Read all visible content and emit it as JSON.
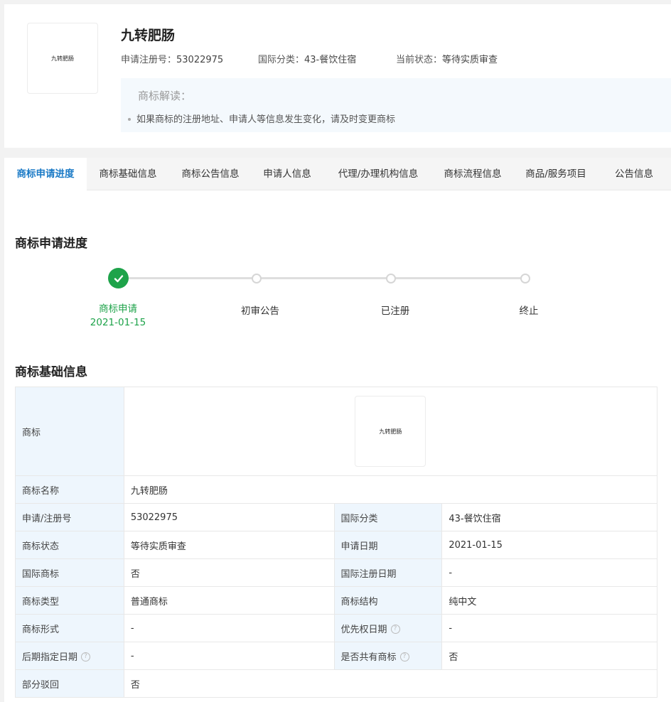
{
  "header": {
    "logo_text": "九转肥肠",
    "title": "九转肥肠",
    "reg_no_label": "申请注册号：",
    "reg_no": "53022975",
    "class_label": "国际分类：",
    "class_value": "43-餐饮住宿",
    "status_label": "当前状态：",
    "status_value": "等待实质审查",
    "interp_title": "商标解读：",
    "interp_item": "如果商标的注册地址、申请人等信息发生变化，请及时变更商标"
  },
  "tabs": [
    {
      "label": "商标申请进度"
    },
    {
      "label": "商标基础信息"
    },
    {
      "label": "商标公告信息"
    },
    {
      "label": "申请人信息"
    },
    {
      "label": "代理/办理机构信息"
    },
    {
      "label": "商标流程信息"
    },
    {
      "label": "商品/服务项目"
    },
    {
      "label": "公告信息"
    }
  ],
  "progress": {
    "title": "商标申请进度",
    "steps": [
      {
        "label": "商标申请",
        "date": "2021-01-15",
        "done": true
      },
      {
        "label": "初审公告"
      },
      {
        "label": "已注册"
      },
      {
        "label": "终止"
      }
    ]
  },
  "basic": {
    "title": "商标基础信息",
    "logo_label": "商标",
    "logo_text": "九转肥肠",
    "name_label": "商标名称",
    "name_value": "九转肥肠",
    "rows": [
      {
        "l1": "申请/注册号",
        "v1": "53022975",
        "l2": "国际分类",
        "v2": "43-餐饮住宿"
      },
      {
        "l1": "商标状态",
        "v1": "等待实质审查",
        "l2": "申请日期",
        "v2": "2021-01-15"
      },
      {
        "l1": "国际商标",
        "v1": "否",
        "l2": "国际注册日期",
        "v2": "-"
      },
      {
        "l1": "商标类型",
        "v1": "普通商标",
        "l2": "商标结构",
        "v2": "纯中文"
      },
      {
        "l1": "商标形式",
        "v1": "-",
        "l2": "优先权日期",
        "v2": "-"
      },
      {
        "l1": "后期指定日期",
        "v1": "-",
        "l2": "是否共有商标",
        "v2": "否"
      }
    ],
    "partial_label": "部分驳回",
    "partial_value": "否"
  },
  "colors": {
    "accent": "#1a7ac6",
    "success": "#1ea34a",
    "label_bg": "#eef6fd"
  }
}
